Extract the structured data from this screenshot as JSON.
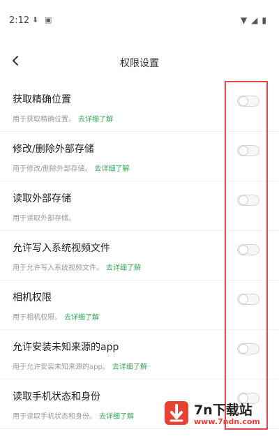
{
  "status_bar": {
    "time": "2:12",
    "icons_left": [
      "download-icon",
      "image-icon"
    ],
    "icons_right": [
      "wifi-icon",
      "signal-icon",
      "battery-icon"
    ]
  },
  "header": {
    "title": "权限设置"
  },
  "items": [
    {
      "title": "获取精确位置",
      "desc": "用于获取精确位置。",
      "link": "去详细了解",
      "enabled": false
    },
    {
      "title": "修改/删除外部存储",
      "desc": "用于修改/删除外部存储。",
      "link": "去详细了解",
      "enabled": false
    },
    {
      "title": "读取外部存储",
      "desc": "用于读取外部存储。",
      "link": "",
      "enabled": false
    },
    {
      "title": "允许写入系统视频文件",
      "desc": "用于允许写入系统视频文件。",
      "link": "去详细了解",
      "enabled": false
    },
    {
      "title": "相机权限",
      "desc": "用于相机权限。",
      "link": "去详细了解",
      "enabled": false
    },
    {
      "title": "允许安装未知来源的app",
      "desc": "用于允许安装未知来源的app。",
      "link": "去详细了解",
      "enabled": false
    },
    {
      "title": "读取手机状态和身份",
      "desc": "用于读取手机状态和身份。",
      "link": "去详细了解",
      "enabled": false
    }
  ],
  "watermark": {
    "brand": "7n下载站",
    "url": "www.7ndn.com"
  },
  "colors": {
    "accent_link": "#3aa657",
    "highlight_border": "#e24a4a",
    "brand_red": "#e84235"
  }
}
